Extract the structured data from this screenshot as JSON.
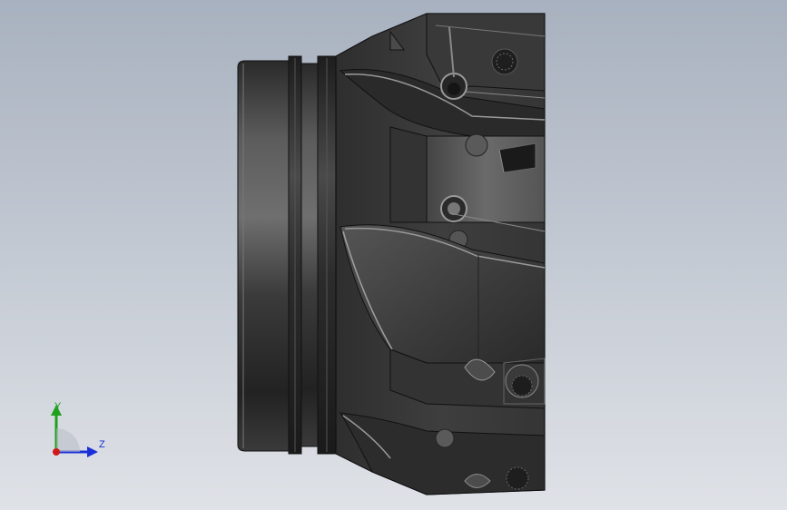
{
  "viewport": {
    "background_top": "#a8b1bf",
    "background_bottom": "#dfe2e7"
  },
  "model": {
    "body_color": "#3a3a3a",
    "shade_color": "#1c1c1c",
    "highlight_color": "#8c8c8c"
  },
  "triad": {
    "y_label": "Y",
    "z_label": "Z",
    "y_color": "#1fa01f",
    "z_color": "#1a2fd8",
    "x_color": "#d01818"
  }
}
